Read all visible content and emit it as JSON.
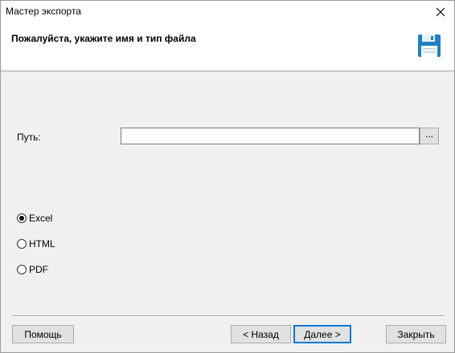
{
  "window": {
    "title": "Мастер экспорта"
  },
  "header": {
    "title": "Пожалуйста, укажите имя и тип файла"
  },
  "path": {
    "label": "Путь:",
    "value": "",
    "browse_label": "..."
  },
  "formats": [
    {
      "label": "Excel",
      "selected": true
    },
    {
      "label": "HTML",
      "selected": false
    },
    {
      "label": "PDF",
      "selected": false
    }
  ],
  "buttons": {
    "help": "Помощь",
    "back": "< Назад",
    "next": "Далее >",
    "close": "Закрыть"
  },
  "colors": {
    "accent": "#0078d7",
    "save_icon": "#1f7fc4"
  }
}
